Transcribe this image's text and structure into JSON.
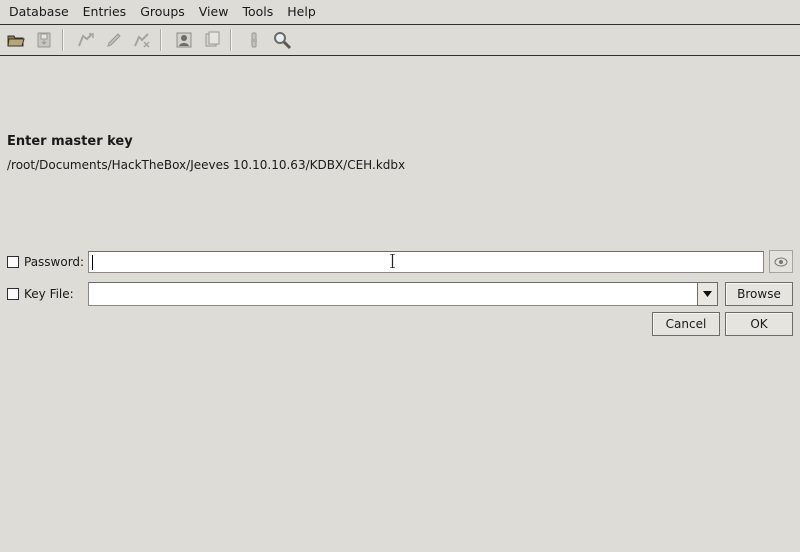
{
  "menu": [
    "Database",
    "Entries",
    "Groups",
    "View",
    "Tools",
    "Help"
  ],
  "toolbar": {
    "icons": [
      "open-database-icon",
      "save-database-icon",
      "add-entry-icon",
      "edit-entry-icon",
      "delete-entry-icon",
      "copy-username-icon",
      "copy-password-icon",
      "lock-workspace-icon",
      "search-icon"
    ]
  },
  "dialog": {
    "title": "Enter master key",
    "path": "/root/Documents/HackTheBox/Jeeves 10.10.10.63/KDBX/CEH.kdbx",
    "password_label": "Password:",
    "password_value": "",
    "keyfile_label": "Key File:",
    "keyfile_value": "",
    "browse_label": "Browse",
    "cancel_label": "Cancel",
    "ok_label": "OK"
  },
  "colors": {
    "window_bg": "#dedcd6",
    "field_bg": "#ffffff",
    "border": "#2e2e2e"
  }
}
